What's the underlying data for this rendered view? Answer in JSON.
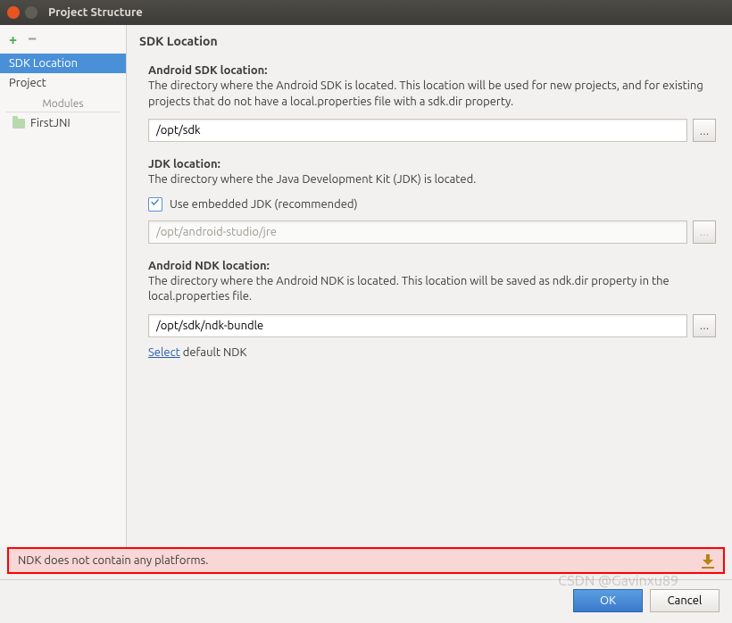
{
  "window": {
    "title": "Project Structure"
  },
  "sidebar": {
    "items": [
      {
        "label": "SDK Location",
        "selected": true
      },
      {
        "label": "Project",
        "selected": false
      }
    ],
    "modules_header": "Modules",
    "modules": [
      {
        "label": "FirstJNI"
      }
    ]
  },
  "content": {
    "heading": "SDK Location",
    "sdk": {
      "title": "Android SDK location:",
      "desc": "The directory where the Android SDK is located. This location will be used for new projects, and for existing projects that do not have a local.properties file with a sdk.dir property.",
      "value": "/opt/sdk"
    },
    "jdk": {
      "title": "JDK location:",
      "desc": "The directory where the Java Development Kit (JDK) is located.",
      "checkbox_label": "Use embedded JDK (recommended)",
      "checked": true,
      "value": "/opt/android-studio/jre"
    },
    "ndk": {
      "title": "Android NDK location:",
      "desc": "The directory where the Android NDK is located. This location will be saved as ndk.dir property in the local.properties file.",
      "value": "/opt/sdk/ndk-bundle",
      "select_link": "Select",
      "select_suffix": " default NDK"
    }
  },
  "error": {
    "message": "NDK does not contain any platforms."
  },
  "footer": {
    "ok": "OK",
    "cancel": "Cancel"
  },
  "watermark": "CSDN @Gavinxu89"
}
